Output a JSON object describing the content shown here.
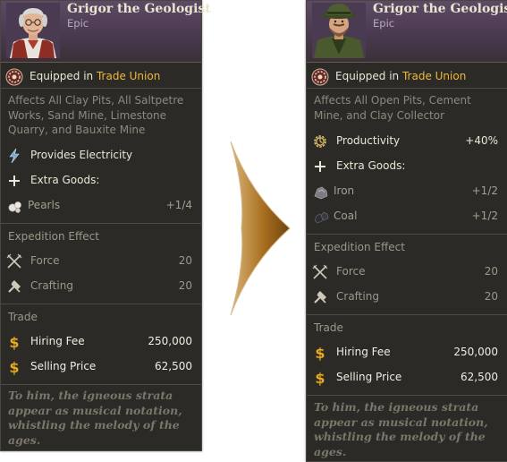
{
  "left_card": {
    "name": "Grigor the Geologist",
    "rarity": "Epic",
    "equipped_prefix": "Equipped in",
    "equipped_building": "Trade Union",
    "affects_description": "Affects All Clay Pits, All Saltpetre Works, Sand Mine, Limestone Quarry, and Bauxite Mine",
    "perks": {
      "electricity_label": "Provides Electricity",
      "extra_goods_label": "Extra Goods:",
      "goods": [
        {
          "label": "Pearls",
          "value": "+1/4",
          "icon": "pearls-icon"
        }
      ]
    },
    "expedition": {
      "title": "Expedition Effect",
      "force_label": "Force",
      "force_value": "20",
      "crafting_label": "Crafting",
      "crafting_value": "20"
    },
    "trade": {
      "title": "Trade",
      "hiring_fee_label": "Hiring Fee",
      "hiring_fee_value": "250,000",
      "selling_price_label": "Selling Price",
      "selling_price_value": "62,500"
    },
    "flavor_text": "To him, the igneous strata appear as musical notation, whistling the melody of the ages."
  },
  "right_card": {
    "name": "Grigor the Geologist",
    "rarity": "Epic",
    "equipped_prefix": "Equipped in",
    "equipped_building": "Trade Union",
    "affects_description": "Affects All Open Pits, Cement Mine, and Clay Collector",
    "perks": {
      "productivity_label": "Productivity",
      "productivity_value": "+40%",
      "extra_goods_label": "Extra Goods:",
      "goods": [
        {
          "label": "Iron",
          "value": "+1/2",
          "icon": "iron-icon"
        },
        {
          "label": "Coal",
          "value": "+1/2",
          "icon": "coal-icon"
        }
      ]
    },
    "expedition": {
      "title": "Expedition Effect",
      "force_label": "Force",
      "force_value": "20",
      "crafting_label": "Crafting",
      "crafting_value": "20"
    },
    "trade": {
      "title": "Trade",
      "hiring_fee_label": "Hiring Fee",
      "hiring_fee_value": "250,000",
      "selling_price_label": "Selling Price",
      "selling_price_value": "62,500"
    },
    "flavor_text": "To him, the igneous strata appear as musical notation, whistling the melody of the ages."
  },
  "colors": {
    "card_background": "#2b2a26",
    "header_purple": "#4a3a50",
    "highlight_gold": "#f0b83a",
    "arrow_brown": "#8a5a14"
  }
}
